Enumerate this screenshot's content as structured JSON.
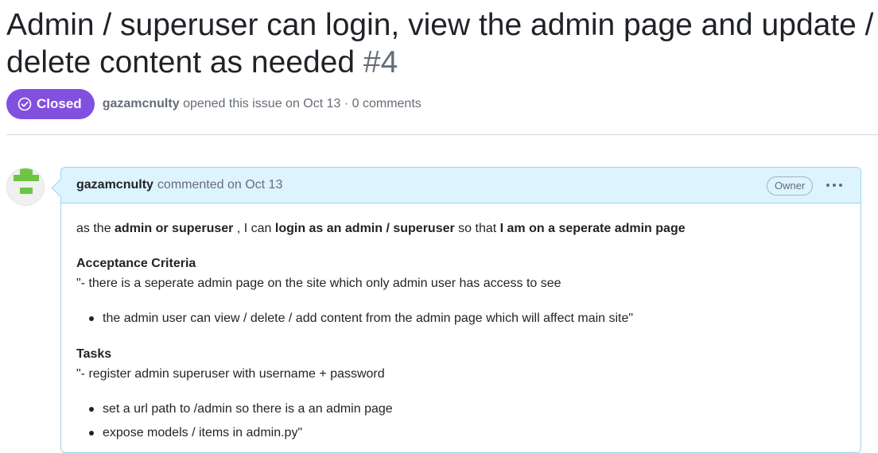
{
  "issue": {
    "title": "Admin / superuser can login, view the admin page and update / delete content as needed",
    "number": "#4",
    "state": "Closed",
    "state_color": "#8250df",
    "author": "gazamcnulty",
    "opened_text": "opened this issue on Oct 13 · 0 comments"
  },
  "comment": {
    "author": "gazamcnulty",
    "action_text": "commented on Oct 13",
    "role_badge": "Owner",
    "menu_icon": "kebab-horizontal-icon",
    "body": {
      "p1": {
        "a": "as the ",
        "b": "admin or superuser",
        "c": " , I can ",
        "d": "login as an admin / superuser",
        "e": " so that ",
        "f": "I am on a seperate admin page"
      },
      "heading1": "Acceptance Criteria",
      "line1": "\"- there is a seperate admin page on the site which only admin user has access to see",
      "list1": [
        "the admin user can view / delete / add content from the admin page which will affect main site\""
      ],
      "heading2": "Tasks",
      "line2": "\"- register admin superuser with username + password",
      "list2": [
        "set a url path to /admin so there is a an admin page",
        "expose models / items in admin.py\""
      ]
    }
  }
}
